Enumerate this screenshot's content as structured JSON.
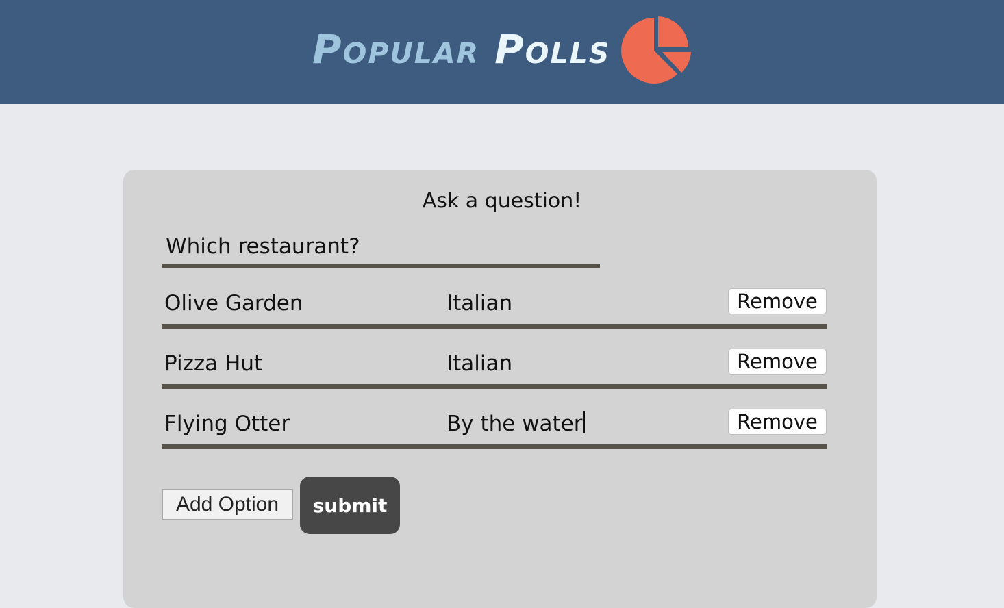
{
  "header": {
    "brand_first": "Popular",
    "brand_second": "Polls",
    "logo_icon": "pie-chart-icon",
    "background_color": "#3e5b80",
    "accent_color": "#ee6b52"
  },
  "form": {
    "title": "Ask a question!",
    "question_value": "Which restaurant?",
    "options": [
      {
        "name": "Olive Garden",
        "description": "Italian",
        "remove_label": "Remove"
      },
      {
        "name": "Pizza Hut",
        "description": "Italian",
        "remove_label": "Remove"
      },
      {
        "name": "Flying Otter",
        "description": "By the water",
        "remove_label": "Remove"
      }
    ],
    "add_option_label": "Add Option",
    "submit_label": "submit"
  }
}
